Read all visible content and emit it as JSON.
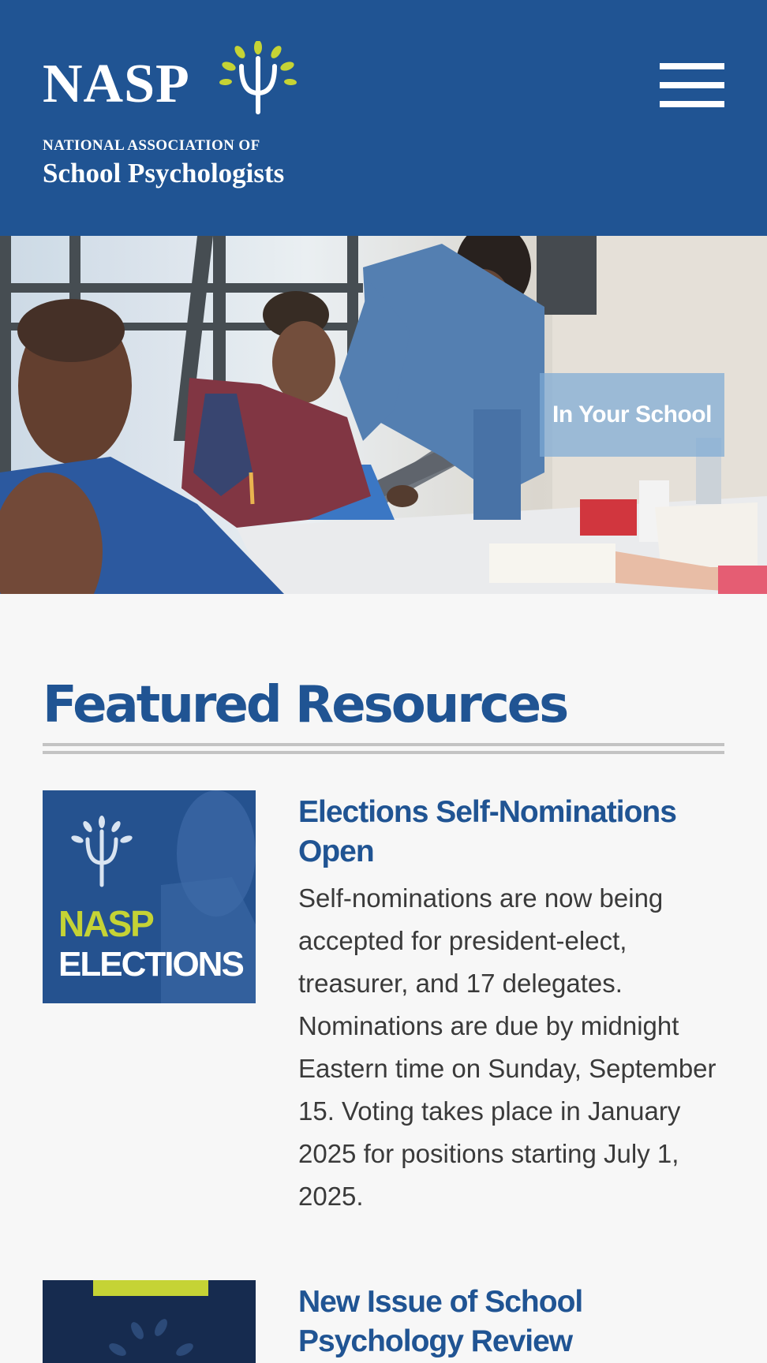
{
  "brand": {
    "logo_mark": "NASP",
    "tagline_top": "NATIONAL ASSOCIATION OF",
    "tagline_bottom": "School Psychologists",
    "color": "#205493",
    "accent": "#c5d335"
  },
  "header": {
    "menu_icon": "hamburger-menu-icon"
  },
  "hero": {
    "caption": "In Your School"
  },
  "featured": {
    "title": "Featured Resources",
    "items": [
      {
        "image_badge_top": "NASP",
        "image_badge_bottom": "ELECTIONS",
        "title": "Elections Self-Nominations Open",
        "body": "Self-nominations are now being accepted for president-elect, treasurer, and 17 delegates. Nominations are due by midnight Eastern time on Sunday, September 15. Voting takes place in January 2025 for positions starting July 1, 2025."
      },
      {
        "title": "New Issue of School Psychology Review"
      }
    ]
  }
}
